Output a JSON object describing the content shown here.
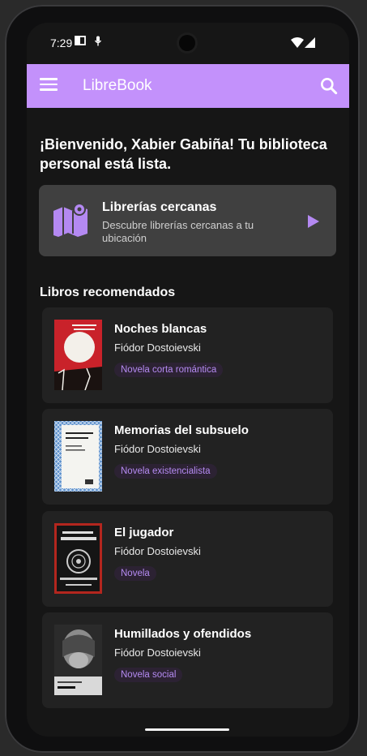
{
  "status": {
    "time": "7:29"
  },
  "appbar": {
    "title": "LibreBook"
  },
  "welcome": "¡Bienvenido, Xabier Gabiña! Tu biblioteca personal está lista.",
  "nearby": {
    "title": "Librerías cercanas",
    "subtitle": "Descubre librerías cercanas a tu ubicación"
  },
  "recommended": {
    "heading": "Libros recomendados"
  },
  "books": [
    {
      "title": "Noches blancas",
      "author": "Fiódor Dostoievski",
      "genre": "Novela corta romántica"
    },
    {
      "title": "Memorias del subsuelo",
      "author": "Fiódor Dostoievski",
      "genre": "Novela existencialista"
    },
    {
      "title": "El jugador",
      "author": "Fiódor Dostoievski",
      "genre": "Novela"
    },
    {
      "title": "Humillados y ofendidos",
      "author": "Fiódor Dostoievski",
      "genre": "Novela social"
    }
  ],
  "colors": {
    "accent": "#c391fb",
    "tag_text": "#b58bf2",
    "background": "#161616",
    "card": "#222222"
  }
}
